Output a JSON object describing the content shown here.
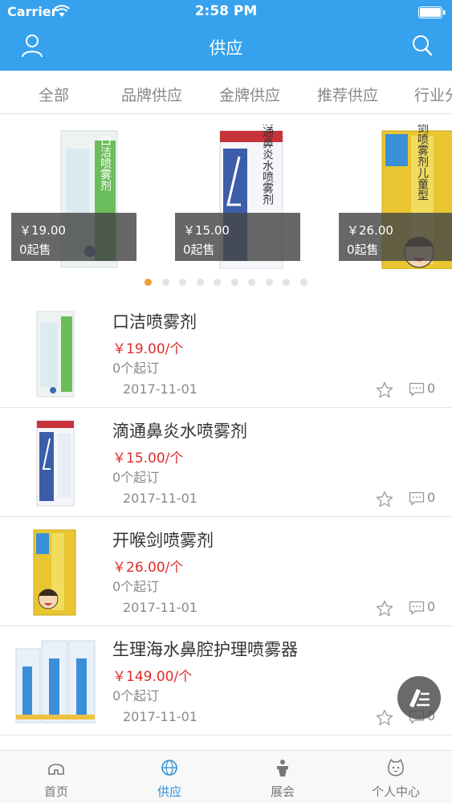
{
  "status_bar": {
    "carrier": "Carrier",
    "time": "2:58 PM"
  },
  "nav": {
    "title": "供应",
    "left_icon": "user-icon",
    "right_icon": "search-icon"
  },
  "tabs": [
    "全部",
    "品牌供应",
    "金牌供应",
    "推荐供应",
    "行业分"
  ],
  "banner": [
    {
      "price": "￥19.00",
      "min_order": "0起售",
      "box_text": "口洁喷雾剂",
      "accent": "#6bbd5c"
    },
    {
      "price": "￥15.00",
      "min_order": "0起售",
      "box_text": "滴通鼻炎水喷雾剂",
      "accent": "#3c5ea8"
    },
    {
      "price": "￥26.00",
      "min_order": "0起售",
      "box_text": "开喉剑喷雾剂儿童型",
      "accent": "#e8c531"
    }
  ],
  "banner_dots": {
    "count": 10,
    "active_index": 0
  },
  "products": [
    {
      "name": "口洁喷雾剂",
      "price": "￥19.00/个",
      "min_order": "0个起订",
      "date": "2017-11-01",
      "comments": "0"
    },
    {
      "name": "滴通鼻炎水喷雾剂",
      "price": "￥15.00/个",
      "min_order": "0个起订",
      "date": "2017-11-01",
      "comments": "0"
    },
    {
      "name": "开喉剑喷雾剂",
      "price": "￥26.00/个",
      "min_order": "0个起订",
      "date": "2017-11-01",
      "comments": "0"
    },
    {
      "name": "生理海水鼻腔护理喷雾器",
      "price": "￥149.00/个",
      "min_order": "0个起订",
      "date": "2017-11-01",
      "comments": "0"
    }
  ],
  "tabbar": [
    {
      "label": "首页",
      "icon": "home-icon"
    },
    {
      "label": "供应",
      "icon": "globe-icon"
    },
    {
      "label": "展会",
      "icon": "trophy-icon"
    },
    {
      "label": "个人中心",
      "icon": "profile-icon"
    }
  ],
  "colors": {
    "primary": "#36a1ec",
    "price": "#e02a2a",
    "dot_active": "#f29d38",
    "tab_active": "#2f8fd8"
  }
}
